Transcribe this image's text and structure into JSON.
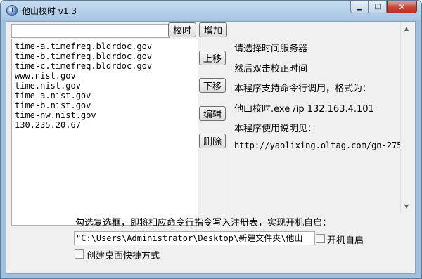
{
  "window": {
    "title": "他山校时 v1.3",
    "minimize_glyph": "▁",
    "maximize_glyph": "□",
    "close_glyph": "✕"
  },
  "toolbar": {
    "sync_label": "校时",
    "add_label": "增加"
  },
  "servers": [
    "time-a.timefreq.bldrdoc.gov",
    "time-b.timefreq.bldrdoc.gov",
    "time-c.timefreq.bldrdoc.gov",
    "www.nist.gov",
    "time.nist.gov",
    "time-a.nist.gov",
    "time-b.nist.gov",
    "time-nw.nist.gov",
    "130.235.20.67"
  ],
  "side_buttons": {
    "up_label": "上移",
    "down_label": "下移",
    "edit_label": "编辑",
    "delete_label": "删除"
  },
  "info": {
    "line1": "请选择时间服务器",
    "line2": "然后双击校正时间",
    "line3": "本程序支持命令行调用，格式为：",
    "line4": "他山校时.exe /ip 132.163.4.101",
    "line5": "本程序使用说明见：",
    "line6": "http://yaolixing.oltag.com/gn-275"
  },
  "footer": {
    "hint": "勾选复选框，即将相应命令行指令写入注册表，实现开机自启：",
    "command_path": "\"C:\\Users\\Administrator\\Desktop\\新建文件夹\\他山",
    "autostart_label": "开机自启",
    "autostart_checked": false,
    "shortcut_label": "创建桌面快捷方式",
    "shortcut_checked": false
  },
  "icons": {
    "app": "clock-icon",
    "scroll_up": "▲",
    "scroll_down": "▼"
  }
}
